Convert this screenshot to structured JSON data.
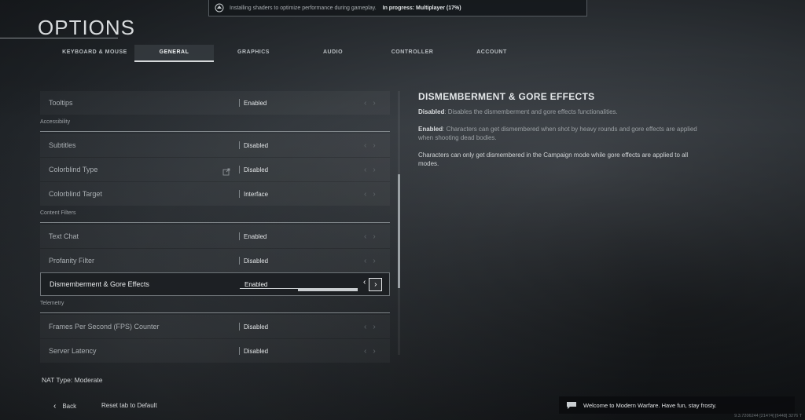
{
  "banner": {
    "text": "Installing shaders to optimize performance during gameplay.",
    "progress": "In progress: Multiplayer (17%)",
    "progress_value": 0.17
  },
  "header": {
    "title": "OPTIONS"
  },
  "tabs": [
    {
      "label": "KEYBOARD & MOUSE",
      "active": false
    },
    {
      "label": "GENERAL",
      "active": true
    },
    {
      "label": "GRAPHICS",
      "active": false
    },
    {
      "label": "AUDIO",
      "active": false
    },
    {
      "label": "CONTROLLER",
      "active": false
    },
    {
      "label": "ACCOUNT",
      "active": false
    }
  ],
  "settings": {
    "tooltips": {
      "label": "Tooltips",
      "value": "Enabled"
    },
    "accessibility_title": "Accessibility",
    "subtitles": {
      "label": "Subtitles",
      "value": "Disabled"
    },
    "colorblind_type": {
      "label": "Colorblind Type",
      "value": "Disabled"
    },
    "colorblind_target": {
      "label": "Colorblind Target",
      "value": "Interface"
    },
    "content_filters_title": "Content Filters",
    "text_chat": {
      "label": "Text Chat",
      "value": "Enabled"
    },
    "profanity_filter": {
      "label": "Profanity Filter",
      "value": "Disabled"
    },
    "gore_effects": {
      "label": "Dismemberment & Gore Effects",
      "value": "Enabled"
    },
    "telemetry_title": "Telemetry",
    "fps_counter": {
      "label": "Frames Per Second (FPS) Counter",
      "value": "Disabled"
    },
    "server_latency": {
      "label": "Server Latency",
      "value": "Disabled"
    }
  },
  "description": {
    "title": "DISMEMBERMENT & GORE EFFECTS",
    "disabled_label": "Disabled",
    "disabled_text": ": Disables the dismemberment and gore effects functionalities.",
    "enabled_label": "Enabled",
    "enabled_text": ": Characters can get dismembered when shot by heavy rounds and gore effects are applied when shooting dead bodies.",
    "note": "Characters can only get dismembered in the Campaign mode while gore effects are applied to all modes."
  },
  "footer": {
    "nat_type": "NAT Type: Moderate",
    "back": "Back",
    "reset": "Reset tab to Default",
    "message": "Welcome to Modern Warfare. Have fun, stay frosty.",
    "version": "9.3.7206244 [21474] [6448] 3276 T"
  },
  "icons": {
    "arrow_left": "‹",
    "arrow_right": "›",
    "chevron_left": "‹"
  },
  "colors": {
    "accent": "#d5d8da",
    "background": "#2a2f33"
  }
}
